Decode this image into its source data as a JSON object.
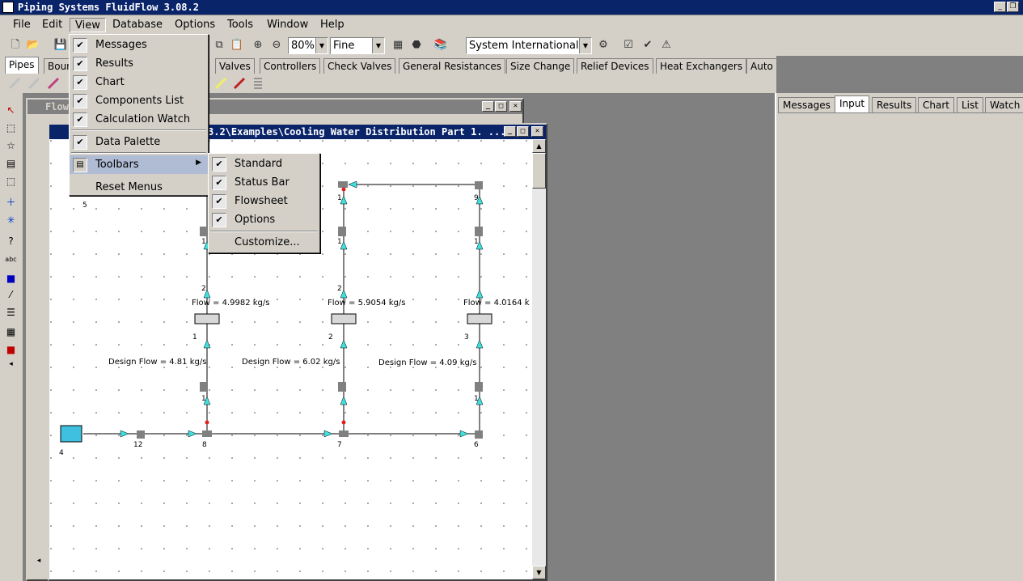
{
  "app": {
    "title": "Piping Systems FluidFlow 3.08.2"
  },
  "menubar": [
    "File",
    "Edit",
    "View",
    "Database",
    "Options",
    "Tools",
    "Window",
    "Help"
  ],
  "toolbar": {
    "zoom": "80%",
    "quality": "Fine",
    "units": "System International"
  },
  "component_tabs": [
    "Pipes",
    "Boun",
    "Valves",
    "Controllers",
    "Check Valves",
    "General Resistances",
    "Size Change",
    "Relief Devices",
    "Heat Exchangers",
    "Auto"
  ],
  "right_panel_tabs": [
    "Messages",
    "Input",
    "Results",
    "Chart",
    "List",
    "Watch"
  ],
  "flowsheet_back_title": "Flows",
  "flowsheet_title": "3.2\\Examples\\Cooling Water Distribution Part 1. ...",
  "view_menu": {
    "items": [
      "Messages",
      "Results",
      "Chart",
      "Components List",
      "Calculation Watch",
      "Data Palette",
      "Toolbars",
      "Reset Menus"
    ]
  },
  "toolbars_submenu": {
    "items": [
      "Standard",
      "Status Bar",
      "Flowsheet",
      "Options",
      "Customize..."
    ]
  },
  "diagram": {
    "flows": [
      "Flow = 4.9982 kg/s",
      "Flow = 5.9054 kg/s",
      "Flow = 4.0164 k"
    ],
    "design_flows": [
      "Design Flow = 4.81 kg/s",
      "Design Flow = 6.02 kg/s",
      "Design Flow = 4.09 kg/s"
    ],
    "node_labels": [
      "5",
      "19",
      "1",
      "2",
      "3",
      "4",
      "12",
      "8",
      "7",
      "6",
      "9",
      "1",
      "1",
      "1",
      "2",
      "2",
      "1",
      "1",
      "1"
    ]
  }
}
